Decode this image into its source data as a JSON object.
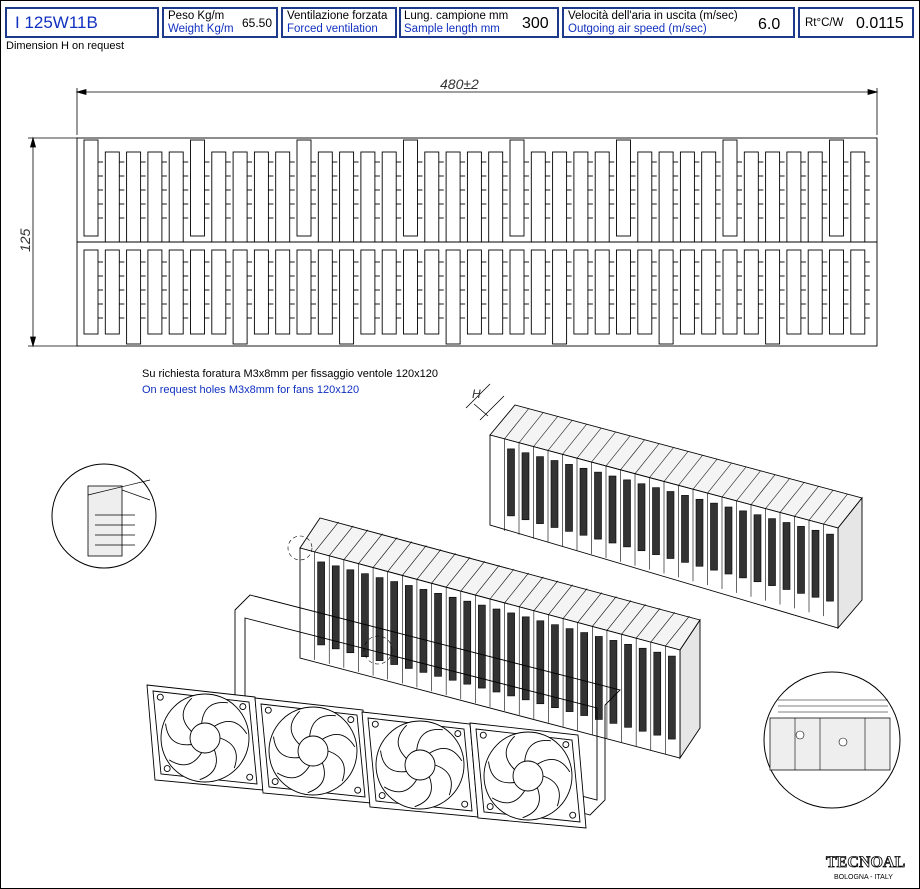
{
  "header": {
    "code": "I 125W11B",
    "weight_it": "Peso Kg/m",
    "weight_en": "Weight Kg/m",
    "weight_value": "65.50",
    "vent_it": "Ventilazione forzata",
    "vent_en": "Forced ventilation",
    "length_it": "Lung. campione mm",
    "length_en": "Sample length mm",
    "length_value": "300",
    "speed_it": "Velocità dell'aria in uscita (m/sec)",
    "speed_en": "Outgoing air speed (m/sec)",
    "speed_value": "6.0",
    "rt_label": "Rt°C/W",
    "rt_value": "0.0115"
  },
  "notes": {
    "dimension_h": "Dimension H on request",
    "holes_it": "Su richiesta foratura M3x8mm per fissaggio ventole 120x120",
    "holes_en": "On request holes M3x8mm for fans 120x120"
  },
  "drawing": {
    "width_dim": "480±2",
    "height_dim": "125",
    "h_label": "H"
  },
  "brand": {
    "logo": "TECNOAL",
    "location": "BOLOGNA - ITALY"
  },
  "colors": {
    "frame": "#1d3a8a",
    "english_text": "#1030c0"
  }
}
